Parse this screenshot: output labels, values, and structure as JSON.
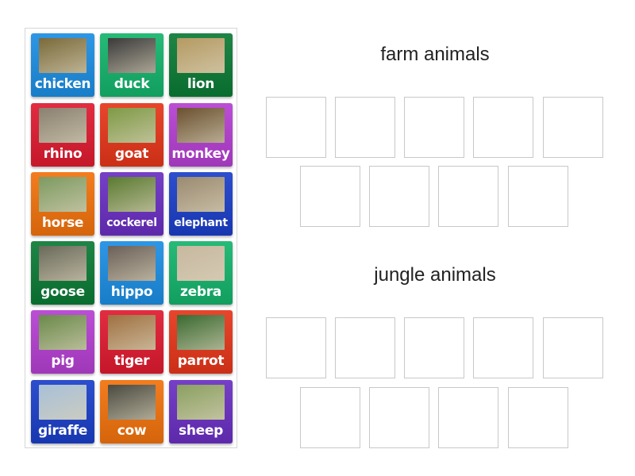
{
  "tiles": [
    {
      "label": "chicken",
      "color": "#1c8ee3",
      "img": "#7a6a3a"
    },
    {
      "label": "duck",
      "color": "#14b46c",
      "img": "#3a3a3a"
    },
    {
      "label": "lion",
      "color": "#0b7b36",
      "img": "#b59a62"
    },
    {
      "label": "rhino",
      "color": "#e01a30",
      "img": "#8a8070"
    },
    {
      "label": "goat",
      "color": "#e6361a",
      "img": "#7e9a45"
    },
    {
      "label": "monkey",
      "color": "#b53fd2",
      "img": "#6a5030"
    },
    {
      "label": "horse",
      "color": "#f2720c",
      "img": "#7d9a60"
    },
    {
      "label": "cockerel",
      "color": "#6a2fc2",
      "img": "#5a7a30"
    },
    {
      "label": "elephant",
      "color": "#1b3fc9",
      "img": "#9a8a70"
    },
    {
      "label": "goose",
      "color": "#0b7b36",
      "img": "#6a6a5a"
    },
    {
      "label": "hippo",
      "color": "#1c8ee3",
      "img": "#6a6058"
    },
    {
      "label": "zebra",
      "color": "#14b46c",
      "img": "#c8b8a0"
    },
    {
      "label": "pig",
      "color": "#b53fd2",
      "img": "#6a8a4a"
    },
    {
      "label": "tiger",
      "color": "#e01a30",
      "img": "#a07040"
    },
    {
      "label": "parrot",
      "color": "#e6361a",
      "img": "#3a6a30"
    },
    {
      "label": "giraffe",
      "color": "#1b3fc9",
      "img": "#a8c0d8"
    },
    {
      "label": "cow",
      "color": "#f2720c",
      "img": "#4a4a40"
    },
    {
      "label": "sheep",
      "color": "#6a2fc2",
      "img": "#8aa060"
    }
  ],
  "groups": [
    {
      "title": "farm animals",
      "slots": 9
    },
    {
      "title": "jungle animals",
      "slots": 9
    }
  ]
}
